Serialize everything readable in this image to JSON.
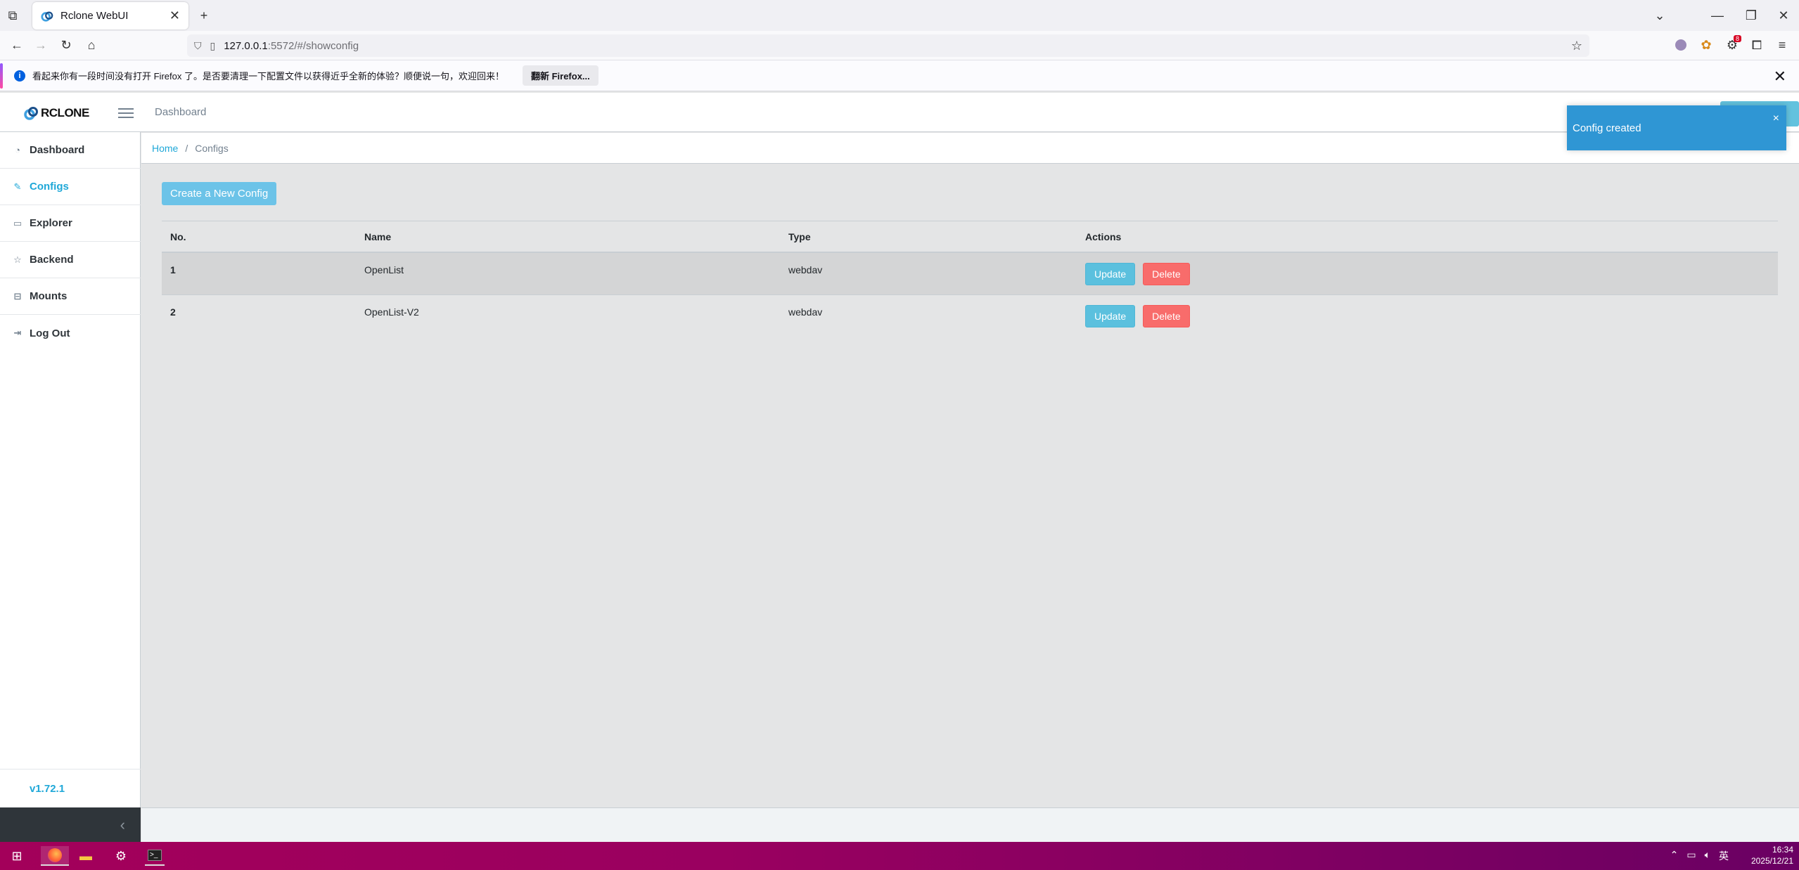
{
  "browser": {
    "tab_title": "Rclone WebUI",
    "url_host": "127.0.0.1",
    "url_path": ":5572/#/showconfig",
    "notification_text": "看起来你有一段时间没有打开 Firefox 了。是否要清理一下配置文件以获得近乎全新的体验？顺便说一句，欢迎回来！",
    "notification_button": "翻新 Firefox...",
    "extension_badge": "8"
  },
  "app": {
    "logo_text": "RCLONE",
    "header_link": "Dashboard",
    "version": "v1.72.1"
  },
  "sidebar": {
    "items": [
      {
        "label": "Dashboard",
        "icon": "speedometer-icon"
      },
      {
        "label": "Configs",
        "icon": "pencil-square-icon",
        "active": true
      },
      {
        "label": "Explorer",
        "icon": "monitor-icon"
      },
      {
        "label": "Backend",
        "icon": "star-icon"
      },
      {
        "label": "Mounts",
        "icon": "drive-icon"
      },
      {
        "label": "Log Out",
        "icon": "logout-icon"
      }
    ]
  },
  "breadcrumb": {
    "home": "Home",
    "separator": "/",
    "current": "Configs"
  },
  "main": {
    "create_button": "Create a New Config",
    "table": {
      "headers": [
        "No.",
        "Name",
        "Type",
        "Actions"
      ],
      "rows": [
        {
          "no": "1",
          "name": "OpenList",
          "type": "webdav"
        },
        {
          "no": "2",
          "name": "OpenList-V2",
          "type": "webdav"
        }
      ],
      "update_label": "Update",
      "delete_label": "Delete"
    }
  },
  "toast": {
    "message": "Config created",
    "close": "×"
  },
  "taskbar": {
    "time": "16:34",
    "date": "2025/12/21",
    "ime": "英"
  },
  "colors": {
    "accent": "#20a8d8",
    "update": "#5bc0de",
    "delete": "#f86c6b",
    "toast": "#2f96d4",
    "taskbar": "#a3005a"
  }
}
